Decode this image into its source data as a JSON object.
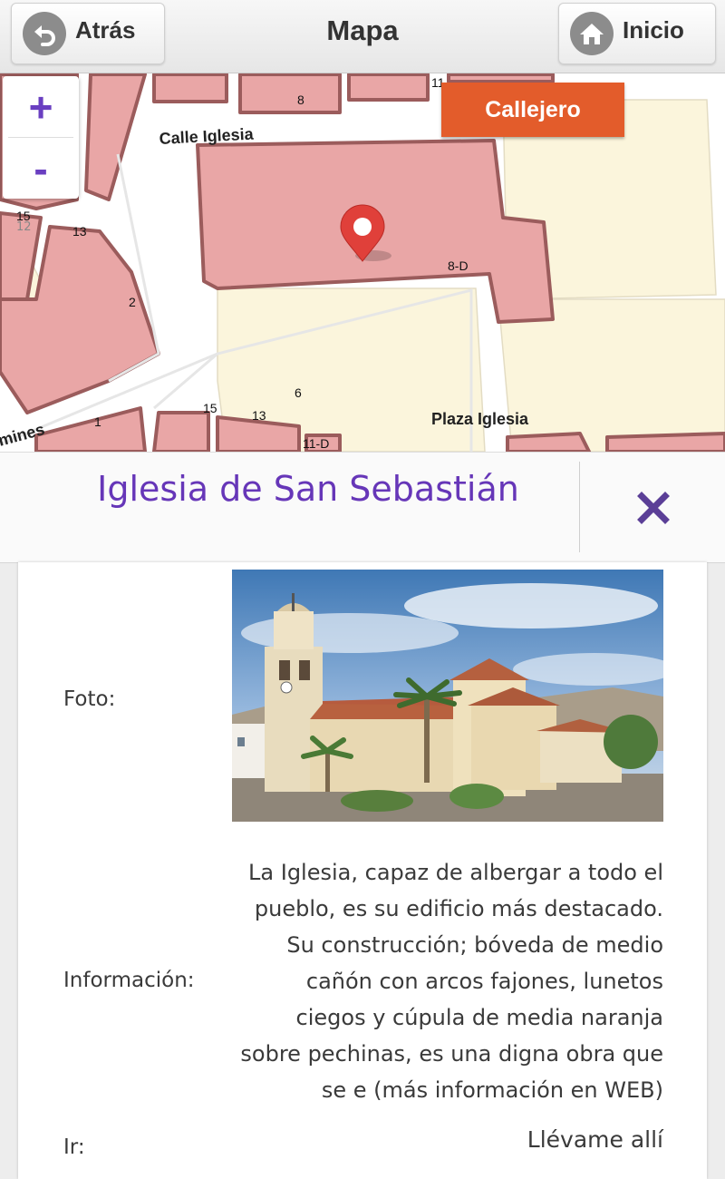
{
  "header": {
    "back_label": "Atrás",
    "title": "Mapa",
    "home_label": "Inicio"
  },
  "map": {
    "zoom_in": "+",
    "zoom_out": "-",
    "zoom_level": "12",
    "layer_button": "Callejero",
    "street_labels": [
      "Calle Iglesia",
      "Plaza Iglesia",
      "mines"
    ],
    "house_numbers": [
      "8",
      "11",
      "15",
      "13",
      "2",
      "8-D",
      "6",
      "15",
      "13",
      "1",
      "11-D"
    ],
    "colors": {
      "building": "#e9a6a6",
      "block": "#fbf5dc",
      "street": "#ffffff",
      "accent": "#e35c2b"
    }
  },
  "place": {
    "name": "Iglesia de San Sebastián",
    "close_icon": "close-icon"
  },
  "details": {
    "photo_label": "Foto:",
    "info_label": "Información:",
    "info_text": "La Iglesia, capaz de albergar a todo el pueblo, es su edificio más destacado. Su construcción; bóveda de medio cañón con arcos fajones, lunetos ciegos y cúpula de media naranja sobre pechinas, es una digna obra que se e (más información en WEB)",
    "go_label": "Ir:",
    "go_link": "Llévame allí"
  }
}
